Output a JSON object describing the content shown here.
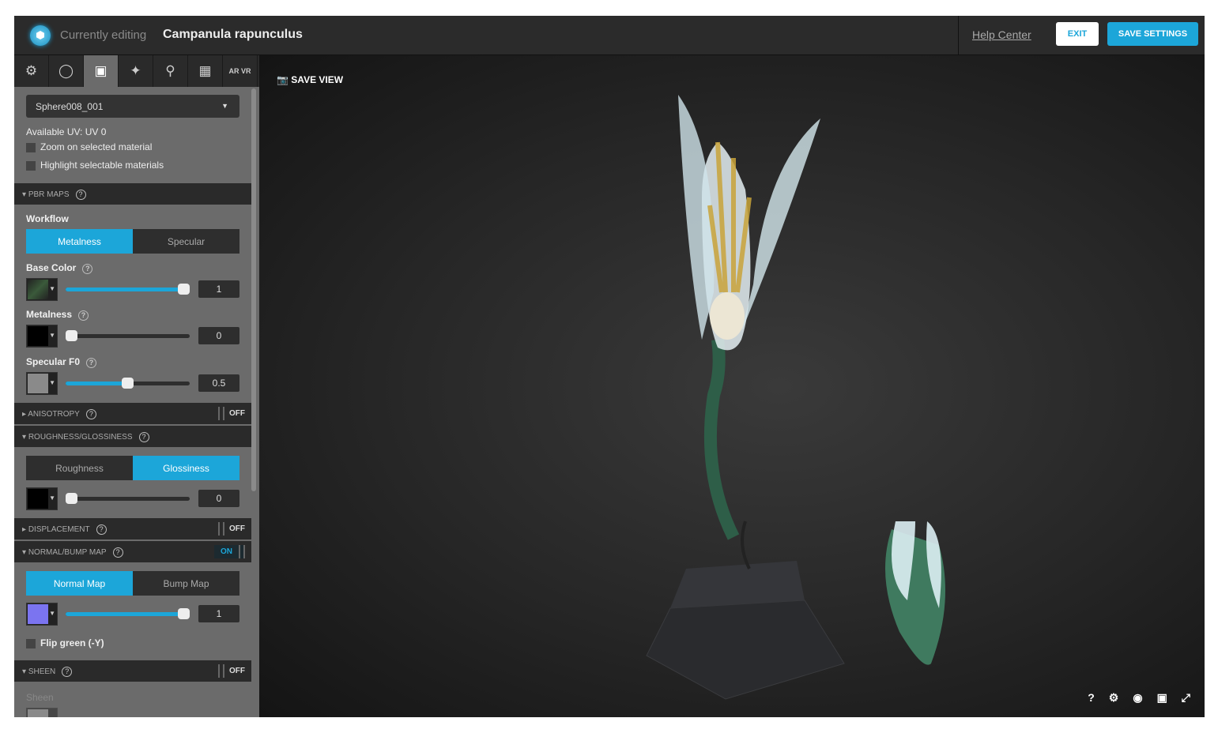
{
  "header": {
    "prefix": "Currently editing",
    "model_name": "Campanula rapunculus",
    "help": "Help Center",
    "exit": "EXIT",
    "save": "SAVE SETTINGS"
  },
  "tabs": [
    {
      "icon": "gear-icon",
      "glyph": "⚙"
    },
    {
      "icon": "lightbulb-icon",
      "glyph": "💡"
    },
    {
      "icon": "image-icon",
      "glyph": "🖼"
    },
    {
      "icon": "magic-wand-icon",
      "glyph": "✨"
    },
    {
      "icon": "location-pin-icon",
      "glyph": "⌖"
    },
    {
      "icon": "film-icon",
      "glyph": "▦"
    },
    {
      "icon": "ar-vr-icon",
      "glyph": "AR VR"
    }
  ],
  "material": {
    "selected": "Sphere008_001",
    "uv": "Available UV: UV 0",
    "zoom_opt": "Zoom on selected material",
    "highlight_opt": "Highlight selectable materials"
  },
  "pbr": {
    "title": "PBR MAPS",
    "workflow_label": "Workflow",
    "workflow": [
      "Metalness",
      "Specular"
    ],
    "base_color": {
      "label": "Base Color",
      "value": "1",
      "fraction": 1
    },
    "metalness": {
      "label": "Metalness",
      "value": "0",
      "fraction": 0
    },
    "specular": {
      "label": "Specular F0",
      "value": "0.5",
      "fraction": 0.5
    }
  },
  "anisotropy": {
    "title": "ANISOTROPY",
    "state": "OFF"
  },
  "roughness": {
    "title": "ROUGHNESS/GLOSSINESS",
    "modes": [
      "Roughness",
      "Glossiness"
    ],
    "value": "0",
    "fraction": 0
  },
  "displacement": {
    "title": "DISPLACEMENT",
    "state": "OFF"
  },
  "normal": {
    "title": "NORMAL/BUMP MAP",
    "state": "ON",
    "modes": [
      "Normal Map",
      "Bump Map"
    ],
    "value": "1",
    "fraction": 1,
    "flip": "Flip green (-Y)"
  },
  "sheen": {
    "title": "SHEEN",
    "state": "OFF",
    "label": "Sheen"
  },
  "viewport": {
    "save_view": "SAVE VIEW",
    "help": "?"
  },
  "colors": {
    "accent": "#1ca6d9",
    "normal_swatch": "#7b74f0"
  }
}
